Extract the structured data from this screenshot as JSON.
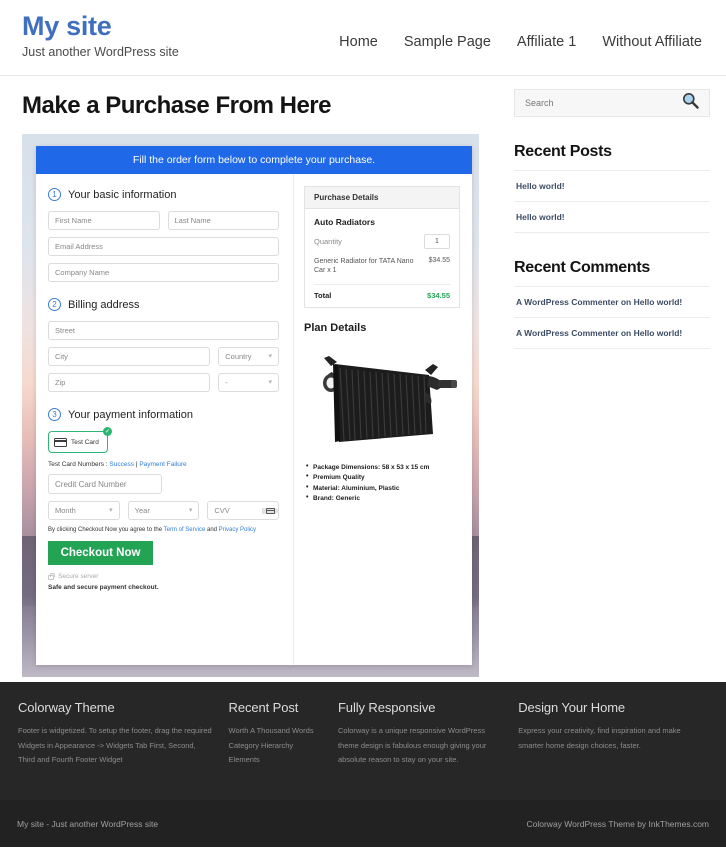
{
  "header": {
    "site_title": "My site",
    "tagline": "Just another WordPress site",
    "nav": [
      {
        "label": "Home"
      },
      {
        "label": "Sample Page"
      },
      {
        "label": "Affiliate 1"
      },
      {
        "label": "Without Affiliate"
      }
    ]
  },
  "main": {
    "page_title": "Make a Purchase From Here",
    "order_banner": "Fill the order form below to complete your purchase.",
    "steps": {
      "step1": {
        "num": "1",
        "label": "Your basic information"
      },
      "step2": {
        "num": "2",
        "label": "Billing address"
      },
      "step3": {
        "num": "3",
        "label": "Your payment information"
      }
    },
    "fields": {
      "first_name": "First Name",
      "last_name": "Last Name",
      "email": "Email Address",
      "company": "Company Name",
      "street": "Street",
      "city": "City",
      "country": "Country",
      "zip": "Zip",
      "state": "-",
      "credit_card": "Credit Card Number",
      "month": "Month",
      "year": "Year",
      "cvv": "CVV"
    },
    "payment": {
      "test_card_label": "Test Card",
      "test_numbers_prefix": "Test Card Numbers : ",
      "success_link": "Success",
      "separator": " | ",
      "failure_link": "Payment Failure",
      "terms_prefix": "By clicking Checkout Now you agree to the ",
      "terms_link": "Term of Service",
      "terms_mid": " and ",
      "privacy_link": "Privacy Policy",
      "checkout_button": "Checkout Now",
      "secure_server": "Secure server",
      "safe_note": "Safe and secure payment checkout."
    },
    "purchase_details": {
      "panel_title": "Purchase Details",
      "product_name": "Auto Radiators",
      "quantity_label": "Quantity",
      "quantity_value": "1",
      "line_item_name": "Generic Radiator for TATA Nano Car x 1",
      "line_item_price": "$34.55",
      "total_label": "Total",
      "total_value": "$34.55"
    },
    "plan": {
      "title": "Plan Details",
      "bullets": [
        "Package Dimensions: 58 x 53 x 15 cm",
        "Premium Quality",
        "Material: Aluminium, Plastic",
        "Brand: Generic"
      ]
    }
  },
  "sidebar": {
    "search_placeholder": "Search",
    "recent_posts": {
      "title": "Recent Posts",
      "items": [
        {
          "label": "Hello world!"
        },
        {
          "label": "Hello world!"
        }
      ]
    },
    "recent_comments": {
      "title": "Recent Comments",
      "items": [
        {
          "label": "A WordPress Commenter on Hello world!"
        },
        {
          "label": "A WordPress Commenter on Hello world!"
        }
      ]
    }
  },
  "footer": {
    "columns": [
      {
        "title": "Colorway Theme",
        "text": "Footer is widgetized. To setup the footer, drag the required Widgets in Appearance -> Widgets Tab First, Second, Third and Fourth Footer Widget"
      },
      {
        "title": "Recent Post",
        "items": [
          {
            "label": "Worth A Thousand Words"
          },
          {
            "label": "Category Hierarchy"
          },
          {
            "label": "Elements"
          }
        ]
      },
      {
        "title": "Fully Responsive",
        "text": "Colorway is a unique responsive WordPress theme design is fabulous enough giving your absolute reason to stay on your site."
      },
      {
        "title": "Design Your Home",
        "text": "Express your creativity, find inspiration and make smarter home design choices, faster."
      }
    ],
    "bottom_left": "My site - Just another WordPress site",
    "bottom_right": "Colorway WordPress Theme by InkThemes.com"
  },
  "colors": {
    "brand_blue": "#3f6fbf",
    "banner_blue": "#1f69e8",
    "accent_green": "#23a455",
    "link_blue": "#2f7fd8",
    "footer_dark": "#272727"
  }
}
